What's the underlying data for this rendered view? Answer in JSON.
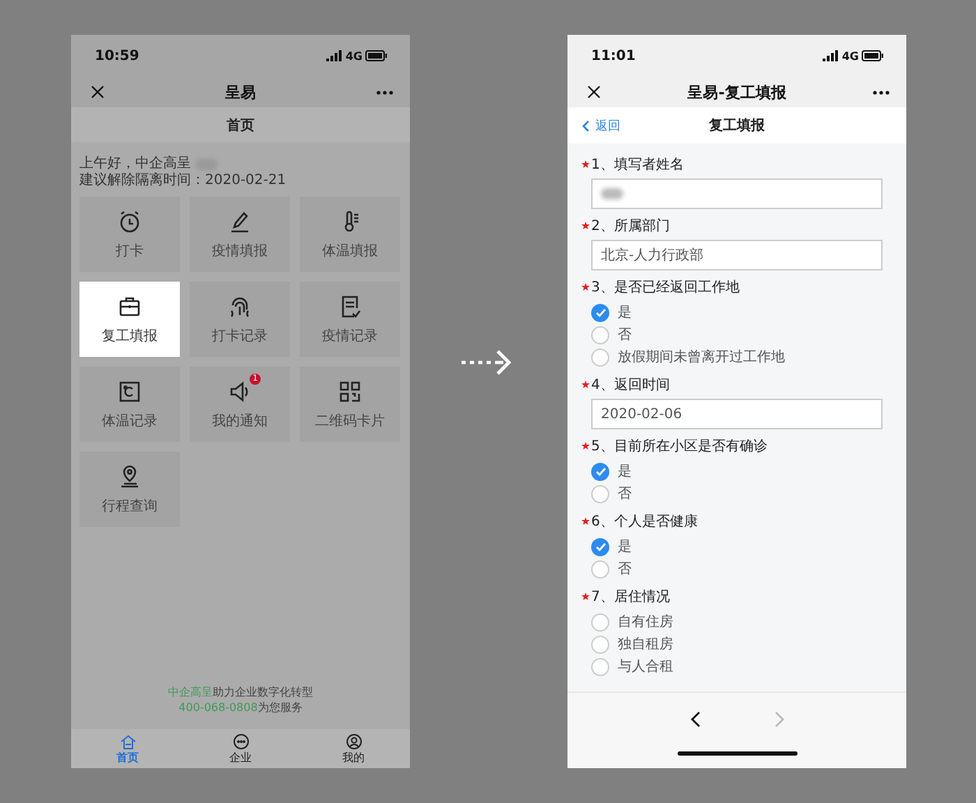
{
  "left_phone": {
    "status_bar": {
      "time": "10:59",
      "network": "4G"
    },
    "title_bar": {
      "title": "呈易"
    },
    "page_header": "首页",
    "greeting": "上午好，中企高呈",
    "greeting_name_redacted": true,
    "notice": "建议解除隔离时间：2020-02-21",
    "tiles": [
      {
        "label": "打卡",
        "selected": false
      },
      {
        "label": "疫情填报",
        "selected": false
      },
      {
        "label": "体温填报",
        "selected": false
      },
      {
        "label": "复工填报",
        "selected": true
      },
      {
        "label": "打卡记录",
        "selected": false
      },
      {
        "label": "疫情记录",
        "selected": false
      },
      {
        "label": "体温记录",
        "selected": false
      },
      {
        "label": "我的通知",
        "selected": false,
        "badge": "1"
      },
      {
        "label": "二维码卡片",
        "selected": false
      },
      {
        "label": "行程查询",
        "selected": false
      }
    ],
    "footer": {
      "brand": "中企高呈",
      "slogan": "助力企业数字化转型",
      "phone": "400-068-0808",
      "service": "为您服务"
    },
    "tabs": [
      {
        "label": "首页",
        "selected": true
      },
      {
        "label": "企业",
        "selected": false
      },
      {
        "label": "我的",
        "selected": false
      }
    ]
  },
  "right_phone": {
    "status_bar": {
      "time": "11:01",
      "network": "4G"
    },
    "title_bar": {
      "title": "呈易-复工填报"
    },
    "nav_bar": {
      "back": "返回",
      "title": "复工填报"
    },
    "questions": [
      {
        "kind": "text",
        "label": "1、填写者姓名",
        "required": true,
        "redacted": true
      },
      {
        "kind": "text",
        "label": "2、所属部门",
        "required": true,
        "value": "北京-人力行政部"
      },
      {
        "kind": "radio",
        "label": "3、是否已经返回工作地",
        "required": true,
        "options": [
          {
            "label": "是",
            "selected": true
          },
          {
            "label": "否",
            "selected": false
          },
          {
            "label": "放假期间未曾离开过工作地",
            "selected": false
          }
        ]
      },
      {
        "kind": "text",
        "label": "4、返回时间",
        "required": true,
        "value": "2020-02-06"
      },
      {
        "kind": "radio",
        "label": "5、目前所在小区是否有确诊",
        "required": true,
        "options": [
          {
            "label": "是",
            "selected": true
          },
          {
            "label": "否",
            "selected": false
          }
        ]
      },
      {
        "kind": "radio",
        "label": "6、个人是否健康",
        "required": true,
        "options": [
          {
            "label": "是",
            "selected": true
          },
          {
            "label": "否",
            "selected": false
          }
        ]
      },
      {
        "kind": "radio",
        "label": "7、居住情况",
        "required": true,
        "options": [
          {
            "label": "自有住房",
            "selected": false
          },
          {
            "label": "独自租房",
            "selected": false
          },
          {
            "label": "与人合租",
            "selected": false
          }
        ]
      }
    ],
    "toolbar": {
      "back_disabled": false,
      "forward_disabled": true
    }
  }
}
